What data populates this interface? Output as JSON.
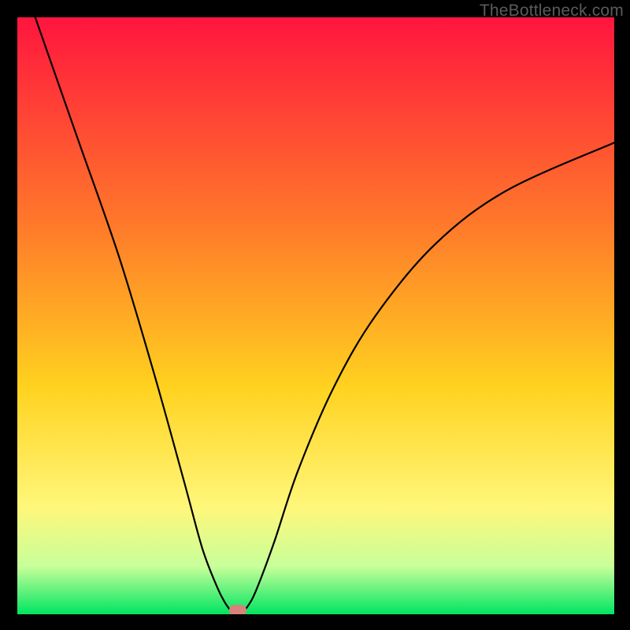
{
  "watermark": "TheBottleneck.com",
  "colors": {
    "frame": "#000000",
    "gradient_top": "#ff153e",
    "gradient_mid1": "#ff7a2a",
    "gradient_mid2": "#ffd21f",
    "gradient_mid3": "#fff77a",
    "gradient_bottom": "#00e561",
    "curve": "#000000",
    "marker": "#d9817c"
  },
  "chart_data": {
    "type": "line",
    "title": "",
    "xlabel": "",
    "ylabel": "",
    "xlim": [
      0,
      100
    ],
    "ylim": [
      0,
      100
    ],
    "grid": false,
    "legend": false,
    "curve_left": {
      "note": "steep descending left branch; x,y as percent of plot area",
      "x": [
        3,
        10,
        17,
        23,
        28,
        31,
        33.5,
        35,
        36,
        36.6
      ],
      "y": [
        100,
        80,
        60,
        40,
        22,
        11,
        4.5,
        1.6,
        0.4,
        0
      ]
    },
    "curve_right": {
      "note": "rising right branch flattening toward right edge; x,y as percent of plot area",
      "x": [
        37.3,
        38.5,
        40,
        43,
        47,
        53,
        60,
        70,
        82,
        100
      ],
      "y": [
        0,
        1.2,
        4,
        12,
        24,
        38,
        50,
        62,
        71,
        79
      ]
    },
    "marker_point": {
      "x": 36.9,
      "y": 0.6
    }
  }
}
